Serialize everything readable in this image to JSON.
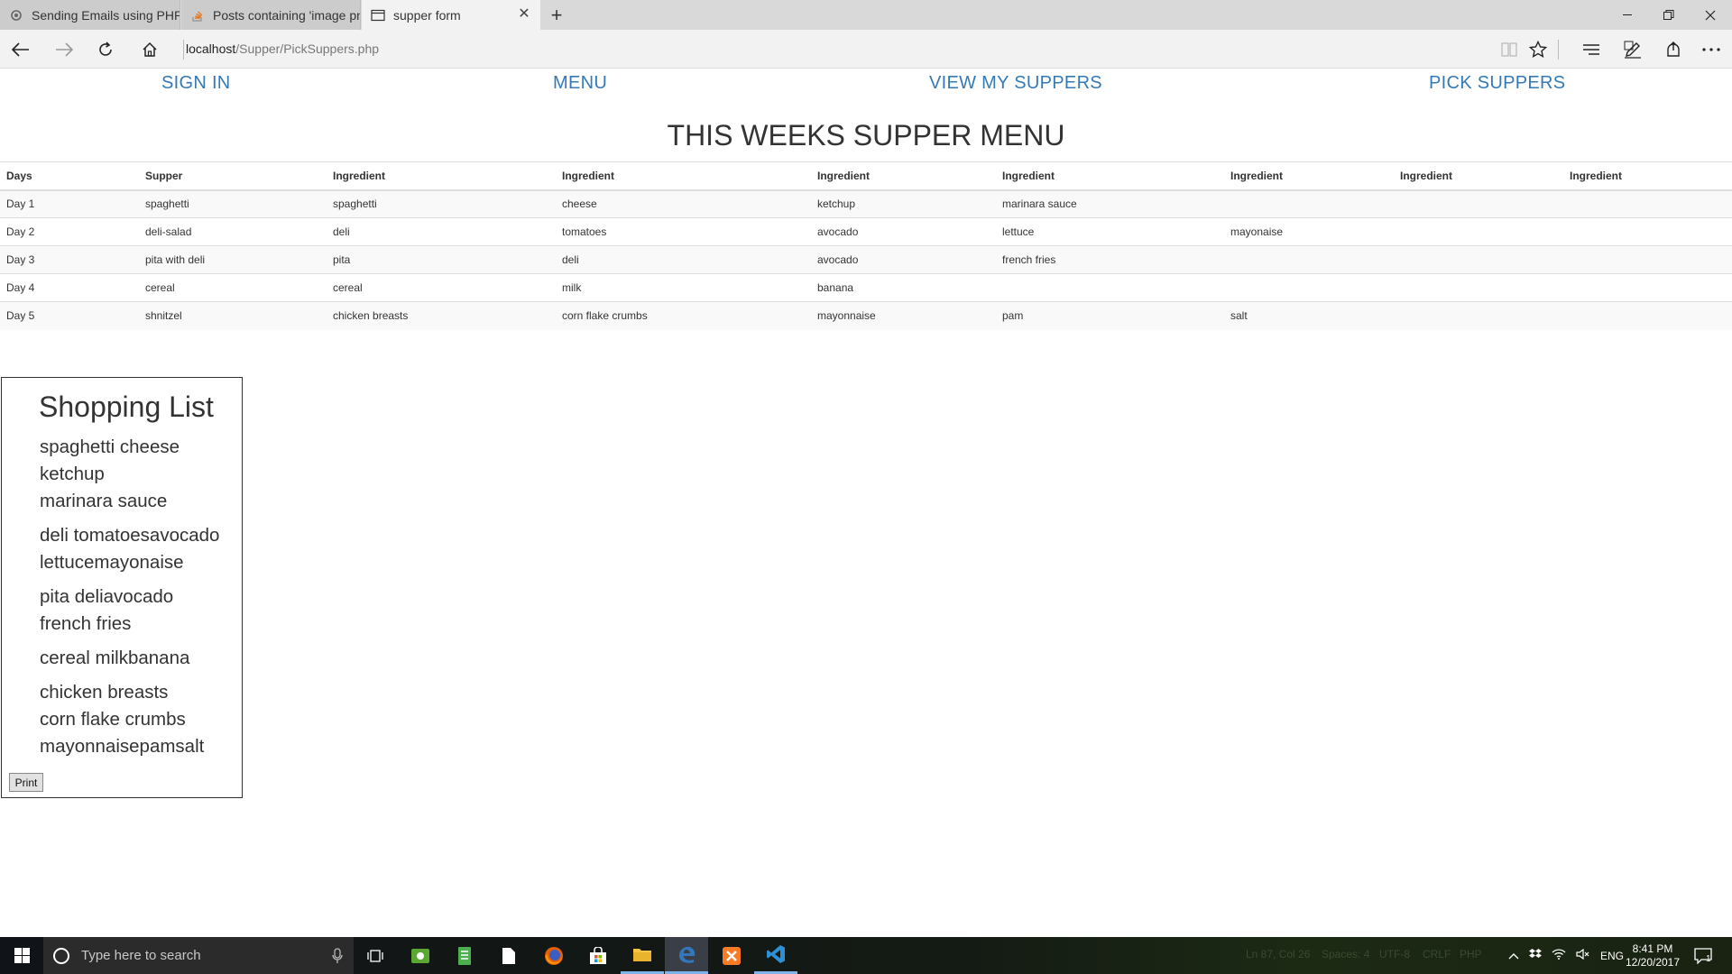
{
  "browser": {
    "tabs": [
      {
        "title": "Sending Emails using PHP",
        "icon": "gear-icon",
        "active": false
      },
      {
        "title": "Posts containing 'image pn",
        "icon": "stack-overflow-icon",
        "active": false
      },
      {
        "title": "supper form",
        "icon": "page-icon",
        "active": true
      }
    ],
    "url_host": "localhost",
    "url_path": "/Supper/PickSuppers.php"
  },
  "nav": {
    "sign_in": "SIGN IN",
    "menu": "MENU",
    "view_my_suppers": "VIEW MY SUPPERS",
    "pick_suppers": "PICK SUPPERS"
  },
  "page_title": "THIS WEEKS SUPPER MENU",
  "table": {
    "headers": [
      "Days",
      "Supper",
      "Ingredient",
      "Ingredient",
      "Ingredient",
      "Ingredient",
      "Ingredient",
      "Ingredient",
      "Ingredient"
    ],
    "rows": [
      [
        "Day 1",
        "spaghetti",
        "spaghetti",
        "cheese",
        "ketchup",
        "marinara sauce",
        "",
        "",
        ""
      ],
      [
        "Day 2",
        "deli-salad",
        "deli",
        "tomatoes",
        "avocado",
        "lettuce",
        "mayonaise",
        "",
        ""
      ],
      [
        "Day 3",
        "pita with deli",
        "pita",
        "deli",
        "avocado",
        "french fries",
        "",
        "",
        ""
      ],
      [
        "Day 4",
        "cereal",
        "cereal",
        "milk",
        "banana",
        "",
        "",
        "",
        ""
      ],
      [
        "Day 5",
        "shnitzel",
        "chicken breasts",
        "corn flake crumbs",
        "mayonnaise",
        "pam",
        "salt",
        "",
        ""
      ]
    ]
  },
  "shopping_list": {
    "title": "Shopping List",
    "groups": [
      [
        "spaghetti cheese",
        "ketchup",
        "marinara sauce"
      ],
      [
        "deli tomatoesavocado",
        "lettucemayonaise"
      ],
      [
        "pita deliavocado",
        "french fries"
      ],
      [
        "cereal milkbanana"
      ],
      [
        "chicken breasts",
        "corn flake crumbs",
        "mayonnaisepamsalt"
      ]
    ],
    "print_label": "Print"
  },
  "taskbar": {
    "search_placeholder": "Type here to search",
    "status_faint": [
      "Ln 87, Col 26",
      "Spaces: 4",
      "UTF-8",
      "CRLF",
      "PHP"
    ],
    "language": "ENG",
    "time": "8:41 PM",
    "date": "12/20/2017",
    "notification_count": "1"
  },
  "colors": {
    "link": "#337ab7",
    "taskbar_accent": "#7fb2e8"
  }
}
